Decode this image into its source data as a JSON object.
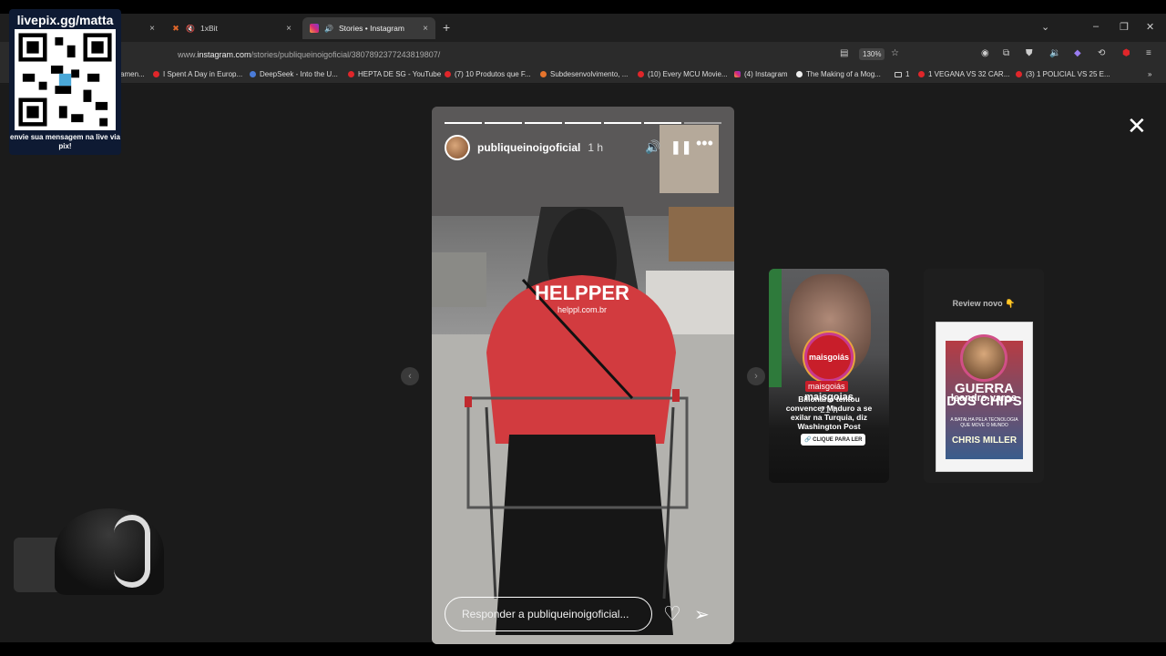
{
  "tabs": [
    {
      "label": "",
      "close": "×"
    },
    {
      "label": "1xBit",
      "close": "×"
    },
    {
      "label": "Stories • Instagram",
      "close": "×"
    }
  ],
  "address_bar": {
    "url_prefix": "www.",
    "url_domain": "instagram.com",
    "url_path": "/stories/publiqueinoigoficial/3807892377243819807/",
    "zoom": "130%"
  },
  "bookmarks": [
    "amen...",
    "I Spent A Day in Europ...",
    "DeepSeek - Into the U...",
    "HEPTA DE SG - YouTube",
    "(7) 10 Produtos que F...",
    "Subdesenvolvimento, ...",
    "(10) Every MCU Movie...",
    "(4) Instagram",
    "The Making of a Mog...",
    "1",
    "1 VEGANA VS 32 CAR...",
    "(3) 1 POLICIAL VS 25 E..."
  ],
  "story": {
    "username": "publiqueinoigoficial",
    "time": "1 h",
    "reply_placeholder": "Responder a publiqueinoigoficial...",
    "shirt_text": "HELPPER",
    "shirt_sub": "helppl.com.br",
    "progress_total": 7,
    "progress_done": 6
  },
  "card1": {
    "avatar_label": "maisgoiás",
    "badge": "maisgoiás",
    "username": "maisgoias",
    "time": "21 h",
    "headline": "Bilionário tentou convencer Maduro a se exilar na Turquia, diz Washington Post",
    "cta": "🔗 CLIQUE PARA LER"
  },
  "card2": {
    "review": "Review novo 👇",
    "username": "leandro.varos",
    "book_title": "GUERRA DOS CHIPS",
    "book_sub": "A BATALHA PELA TECNOLOGIA QUE MOVE O MUNDO",
    "book_author": "CHRIS MILLER"
  },
  "overlay": {
    "qr_title": "livepix.gg/matta",
    "qr_msg": "envie sua mensagem na live via pix!"
  },
  "icons": {
    "close_story": "✕",
    "prev": "‹",
    "next": "›"
  }
}
